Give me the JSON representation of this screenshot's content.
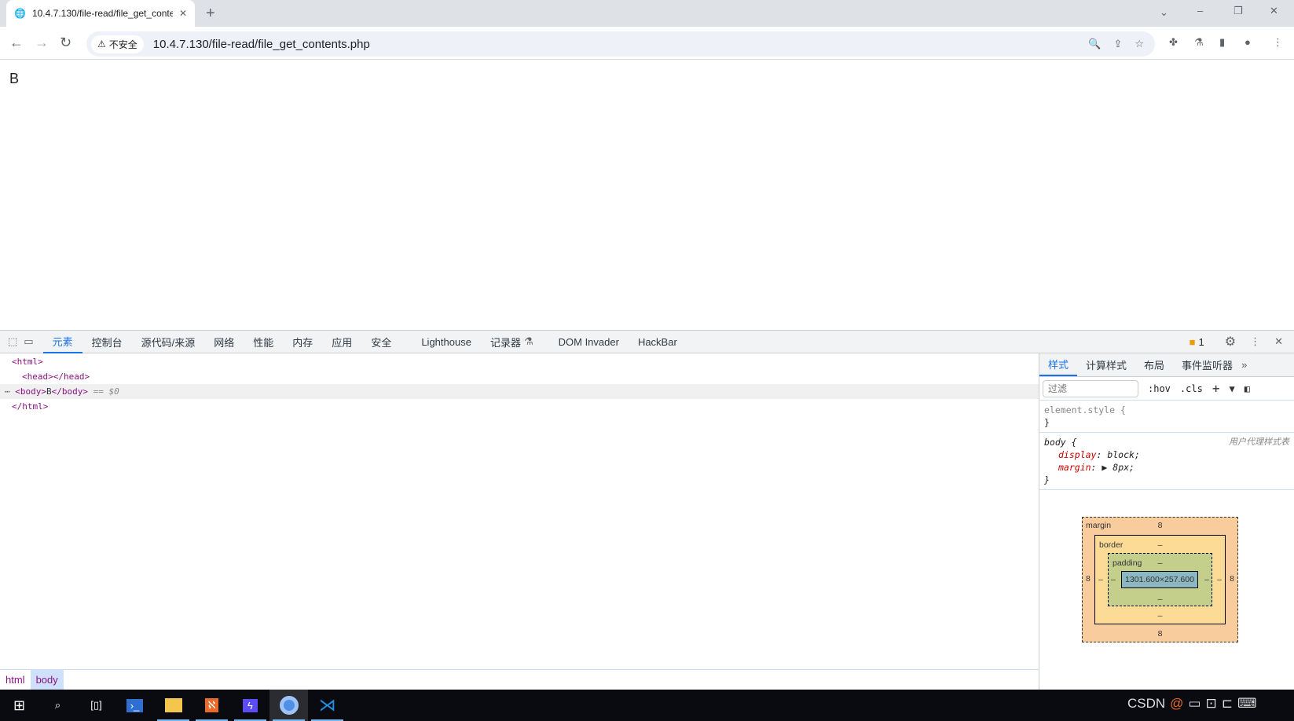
{
  "browser": {
    "tab_title": "10.4.7.130/file-read/file_get_contents.php",
    "security": "不安全",
    "url": "10.4.7.130/file-read/file_get_contents.php"
  },
  "page": {
    "body_text": "B"
  },
  "devtools": {
    "tabs": [
      "元素",
      "控制台",
      "源代码/来源",
      "网络",
      "性能",
      "内存",
      "应用",
      "安全",
      "Lighthouse",
      "记录器",
      "DOM Invader",
      "HackBar"
    ],
    "issues_count": "1",
    "dom": {
      "l1": "<html>",
      "l2": "<head></head>",
      "l3a": "<body>",
      "l3b": "B",
      "l3c": "</body>",
      "l3d": " == $0",
      "l4": "</html>"
    },
    "breadcrumbs": [
      "html",
      "body"
    ],
    "styles": {
      "tabs": [
        "样式",
        "计算样式",
        "布局",
        "事件监听器"
      ],
      "filter_placeholder": "过滤",
      "hov": ":hov",
      "cls": ".cls",
      "element_style": "element.style {",
      "close": "}",
      "body_selector": "body {",
      "ua": "用户代理样式表",
      "p1_name": "display",
      "p1_val": "block;",
      "p2_name": "margin",
      "p2_val": "8px;"
    },
    "box_model": {
      "margin_label": "margin",
      "border_label": "border",
      "padding_label": "padding",
      "margin": "8",
      "border": "–",
      "padding": "–",
      "content": "1301.600×257.600"
    }
  },
  "taskbar": {
    "tray_text": "CSDN"
  }
}
